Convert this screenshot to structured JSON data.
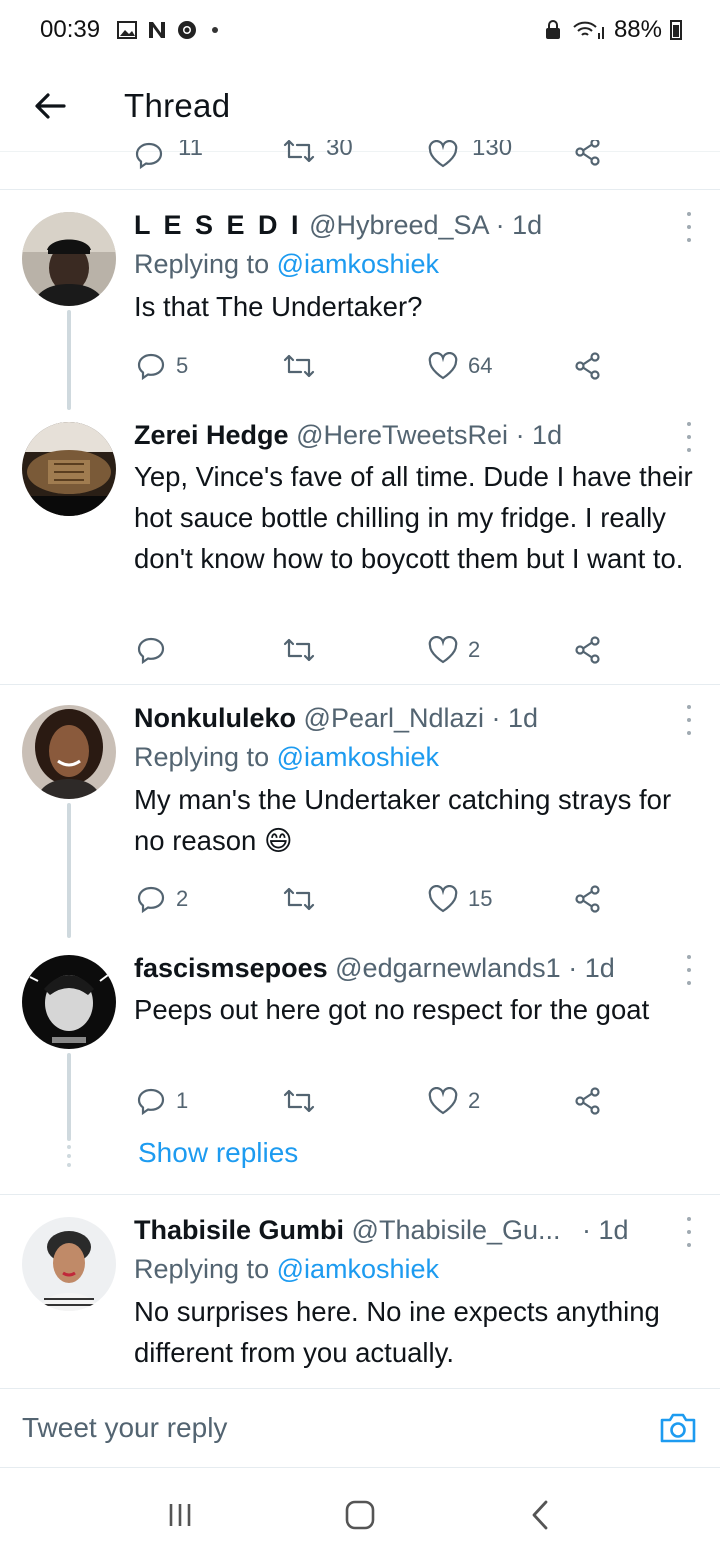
{
  "status_bar": {
    "time": "00:39",
    "battery": "88%"
  },
  "header": {
    "title": "Thread"
  },
  "cut_row": {
    "replies": "11",
    "retweets": "30",
    "likes": "130"
  },
  "tweets": [
    {
      "display_name": "L E S E D I",
      "handle": "@Hybreed_SA",
      "time": " · 1d",
      "reply_prefix": "Replying to ",
      "reply_handle": "@iamkoshiek",
      "text": "Is that The Undertaker?",
      "replies": "5",
      "retweets": "",
      "likes": "64"
    },
    {
      "display_name": "Zerei Hedge",
      "handle": "@HereTweetsRei",
      "time": " · 1d",
      "text": "Yep, Vince's fave of all time. Dude I have their hot sauce bottle chilling in my fridge. I really don't know how to boycott them but I want to.",
      "replies": "",
      "retweets": "",
      "likes": "2"
    },
    {
      "display_name": "Nonkululeko",
      "handle": "@Pearl_Ndlazi",
      "time": " · 1d",
      "reply_prefix": "Replying to ",
      "reply_handle": "@iamkoshiek",
      "text": "My man's the Undertaker catching strays for no reason 😄",
      "replies": "2",
      "retweets": "",
      "likes": "15"
    },
    {
      "display_name": "fascismsepoes",
      "handle": "@edgarnewlands1",
      "time": " · 1d",
      "text": "Peeps out here got no respect for the goat",
      "replies": "1",
      "retweets": "",
      "likes": "2"
    },
    {
      "display_name": "Thabisile Gumbi",
      "handle": "@Thabisile_Gu...",
      "time": " · 1d",
      "reply_prefix": "Replying to ",
      "reply_handle": "@iamkoshiek",
      "text": "No surprises here. No ine expects anything different from you actually."
    }
  ],
  "show_replies_label": "Show replies",
  "reply_bar": {
    "placeholder": "Tweet your reply"
  },
  "colors": {
    "link": "#1d9bf0",
    "muted": "#536471",
    "text": "#0f1419",
    "thread_line": "#cfd9de"
  },
  "icons": [
    "back-arrow-icon",
    "reply-icon",
    "retweet-icon",
    "like-icon",
    "share-icon",
    "camera-icon",
    "more-icon"
  ]
}
